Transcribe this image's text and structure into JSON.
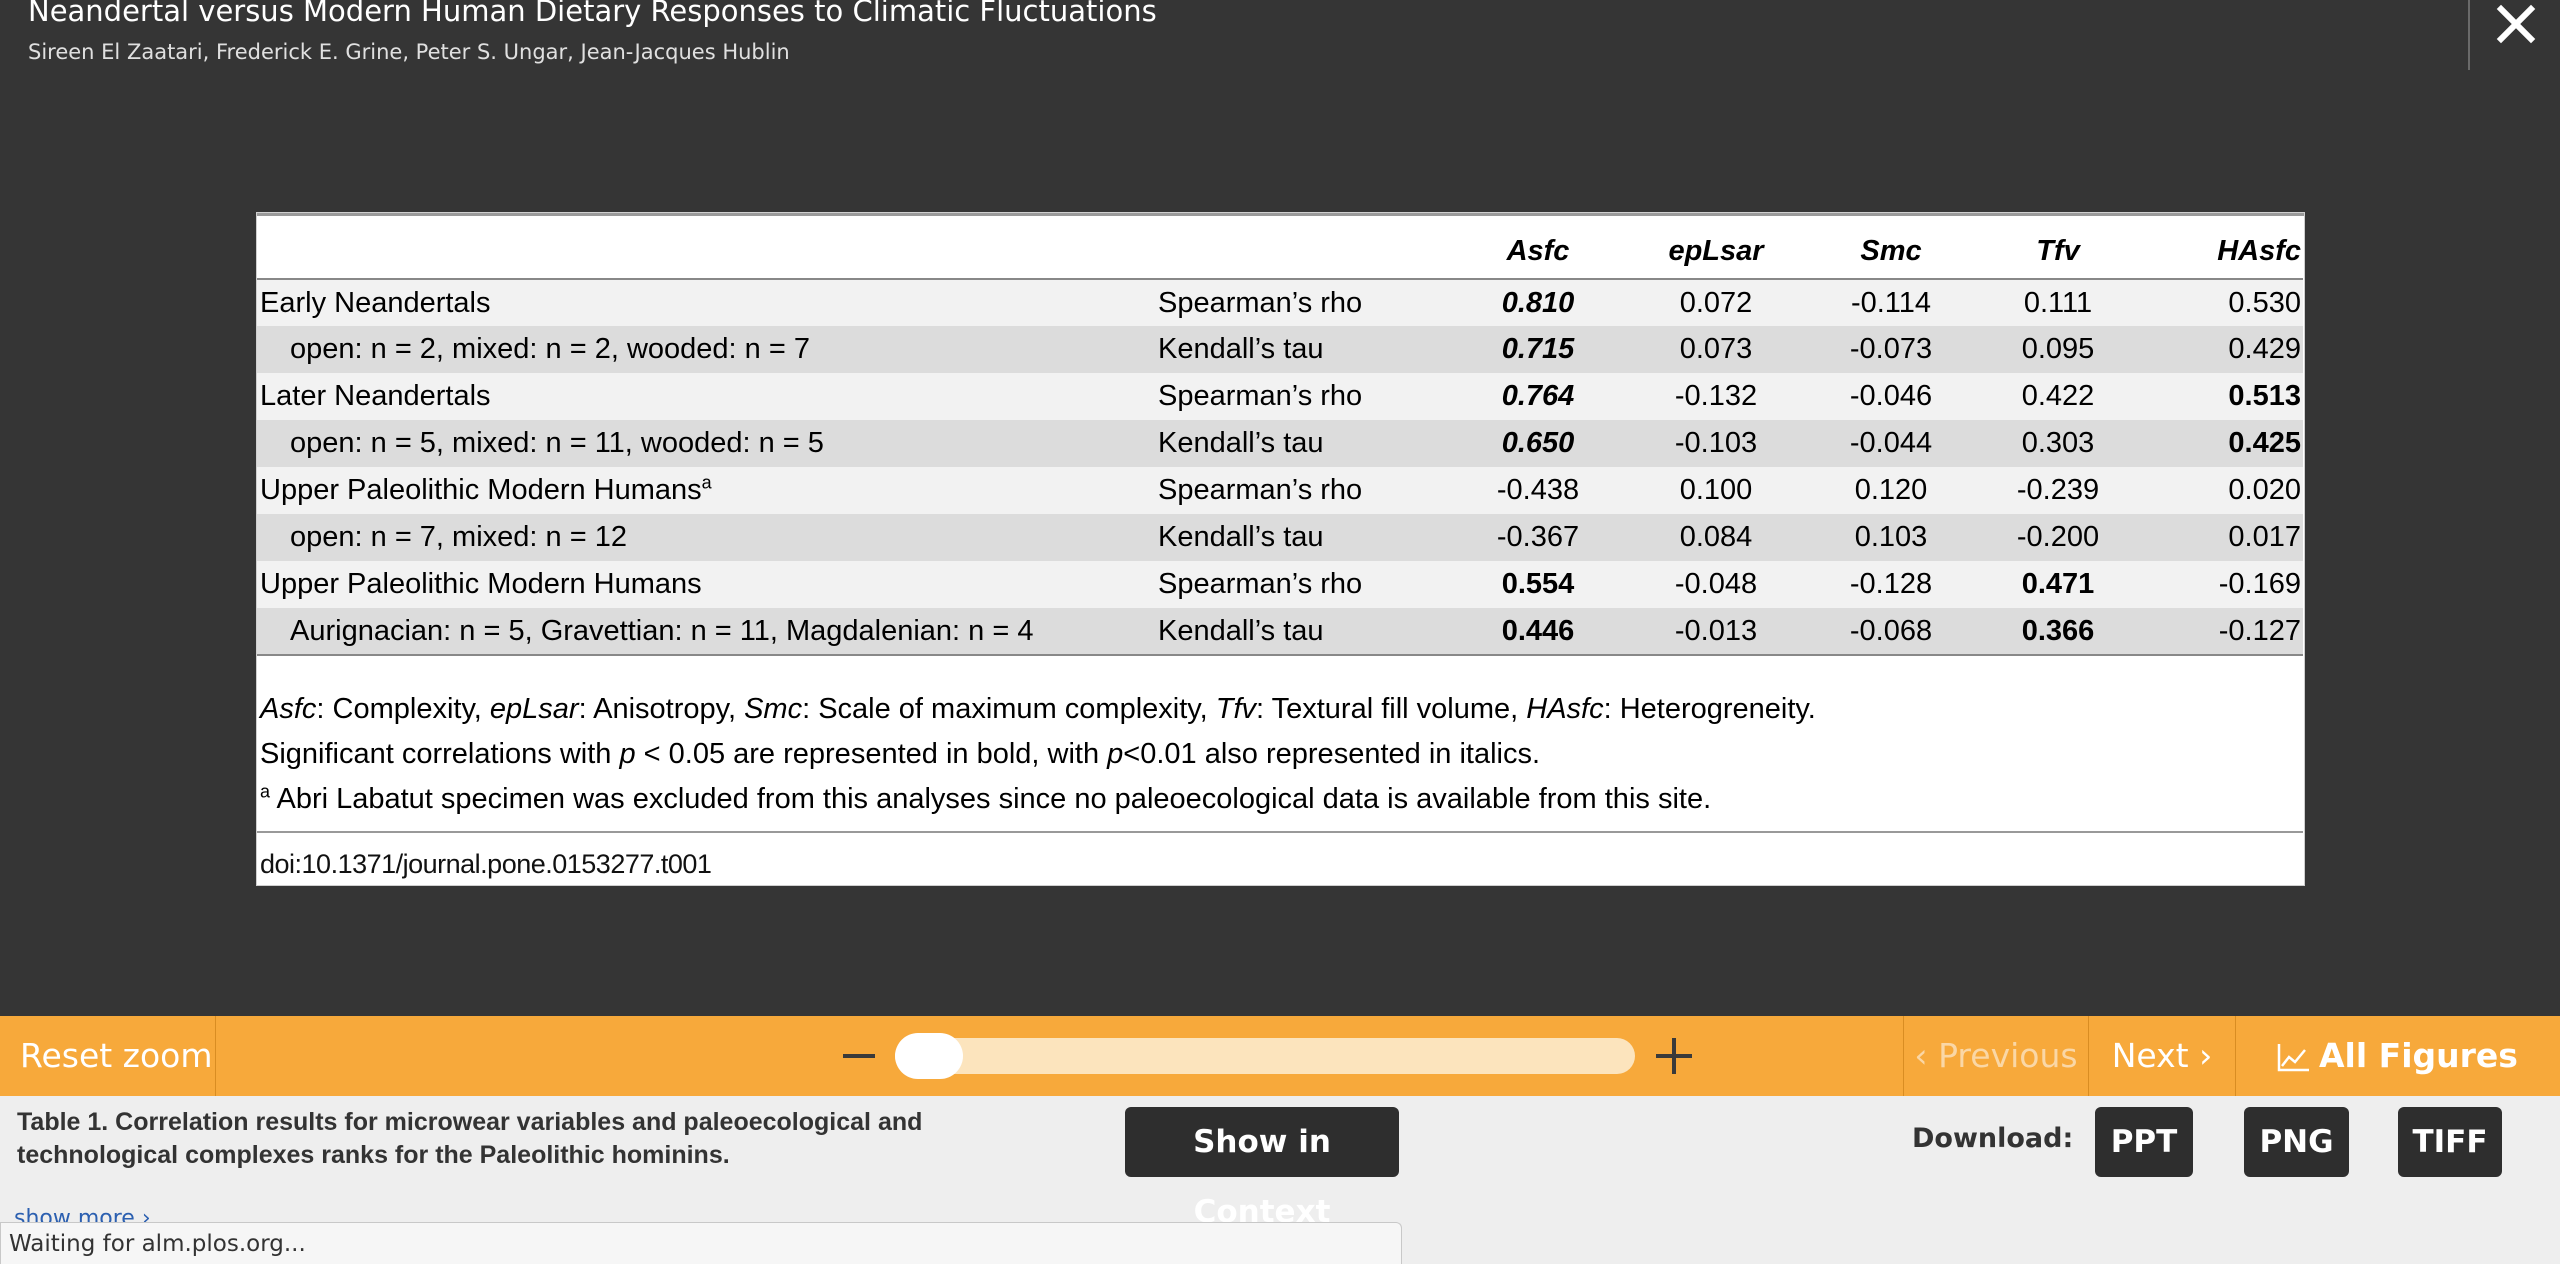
{
  "header": {
    "title": "Neandertal versus Modern Human Dietary Responses to Climatic Fluctuations",
    "authors": "Sireen El Zaatari,  Frederick E. Grine,  Peter S. Ungar,  Jean-Jacques Hublin"
  },
  "table": {
    "columns": [
      "Asfc",
      "epLsar",
      "Smc",
      "Tfv",
      "HAsfc"
    ],
    "rows": [
      {
        "label": "Early Neandertals",
        "test": "Spearman’s rho",
        "values": [
          "0.810",
          "0.072",
          "-0.114",
          "0.111",
          "0.530"
        ]
      },
      {
        "label": "open: n = 2, mixed: n = 2, wooded: n = 7",
        "test": "Kendall’s tau",
        "values": [
          "0.715",
          "0.073",
          "-0.073",
          "0.095",
          "0.429"
        ]
      },
      {
        "label": "Later Neandertals",
        "test": "Spearman’s rho",
        "values": [
          "0.764",
          "-0.132",
          "-0.046",
          "0.422",
          "0.513"
        ]
      },
      {
        "label": "open: n = 5, mixed: n = 11, wooded: n = 5",
        "test": "Kendall’s tau",
        "values": [
          "0.650",
          "-0.103",
          "-0.044",
          "0.303",
          "0.425"
        ]
      },
      {
        "label": "Upper Paleolithic Modern Humans",
        "label_sup": "a",
        "test": "Spearman’s rho",
        "values": [
          "-0.438",
          "0.100",
          "0.120",
          "-0.239",
          "0.020"
        ]
      },
      {
        "label": "open: n = 7, mixed: n = 12",
        "test": "Kendall’s tau",
        "values": [
          "-0.367",
          "0.084",
          "0.103",
          "-0.200",
          "0.017"
        ]
      },
      {
        "label": "Upper Paleolithic Modern Humans",
        "test": "Spearman’s rho",
        "values": [
          "0.554",
          "-0.048",
          "-0.128",
          "0.471",
          "-0.169"
        ]
      },
      {
        "label": "Aurignacian: n = 5, Gravettian: n = 11, Magdalenian: n = 4",
        "test": "Kendall’s tau",
        "values": [
          "0.446",
          "-0.013",
          "-0.068",
          "0.366",
          "-0.127"
        ]
      }
    ],
    "notes": {
      "abbrev": [
        {
          "term": "Asfc",
          "desc": ": Complexity, "
        },
        {
          "term": "epLsar",
          "desc": ": Anisotropy, "
        },
        {
          "term": "Smc",
          "desc": ": Scale of maximum complexity, "
        },
        {
          "term": "Tfv",
          "desc": ": Textural fill volume, "
        },
        {
          "term": "HAsfc",
          "desc": ": Heterogreneity."
        }
      ],
      "sig_part1": "Significant correlations with ",
      "sig_p1": "p",
      "sig_part2": " < 0.05 are represented in bold, with ",
      "sig_p2": "p",
      "sig_part3": "<0.01 also represented in italics.",
      "footnote_mark": "a",
      "footnote": " Abri Labatut specimen was excluded from this analyses since no paleoecological data is available from this site."
    },
    "doi": "doi:10.1371/journal.pone.0153277.t001"
  },
  "toolbar": {
    "reset_zoom": "Reset zoom",
    "previous": "‹ Previous",
    "next": "Next ›",
    "all_figures": "All Figures",
    "zoom_level": 0
  },
  "bottom": {
    "caption": "Table 1. Correlation results for microwear variables and paleoecological and technological complexes ranks for the Paleolithic hominins.",
    "show_more": "show more ›",
    "show_in_context": "Show in Context",
    "download_label": "Download:",
    "downloads": [
      "PPT",
      "PNG",
      "TIFF"
    ]
  },
  "status": "Waiting for alm.plos.org..."
}
